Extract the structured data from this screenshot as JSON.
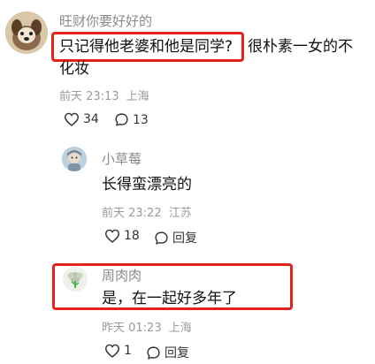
{
  "colors": {
    "highlight": "#e5211c",
    "meta": "#9a9a9a",
    "username": "#8a8a8a"
  },
  "comments": [
    {
      "username": "旺财你要好好的",
      "text_highlighted": "只记得他老婆和他是同学?",
      "text_rest_line1": "很朴素一女的不",
      "text_rest_line2": "化妆",
      "time": "前天 23:13",
      "location": "上海",
      "likes": "34",
      "replies": "13",
      "avatar_icon": "dog-avatar-icon"
    },
    {
      "username": "小草莓",
      "text": "长得蛮漂亮的",
      "time": "前天 23:22",
      "location": "江苏",
      "likes": "18",
      "reply_label": "回复",
      "avatar_icon": "doll-avatar-icon"
    },
    {
      "username": "周肉肉",
      "text": "是，在一起好多年了",
      "time": "昨天 01:23",
      "location": "上海",
      "likes": "1",
      "reply_label": "回复",
      "avatar_icon": "flower-avatar-icon"
    }
  ]
}
